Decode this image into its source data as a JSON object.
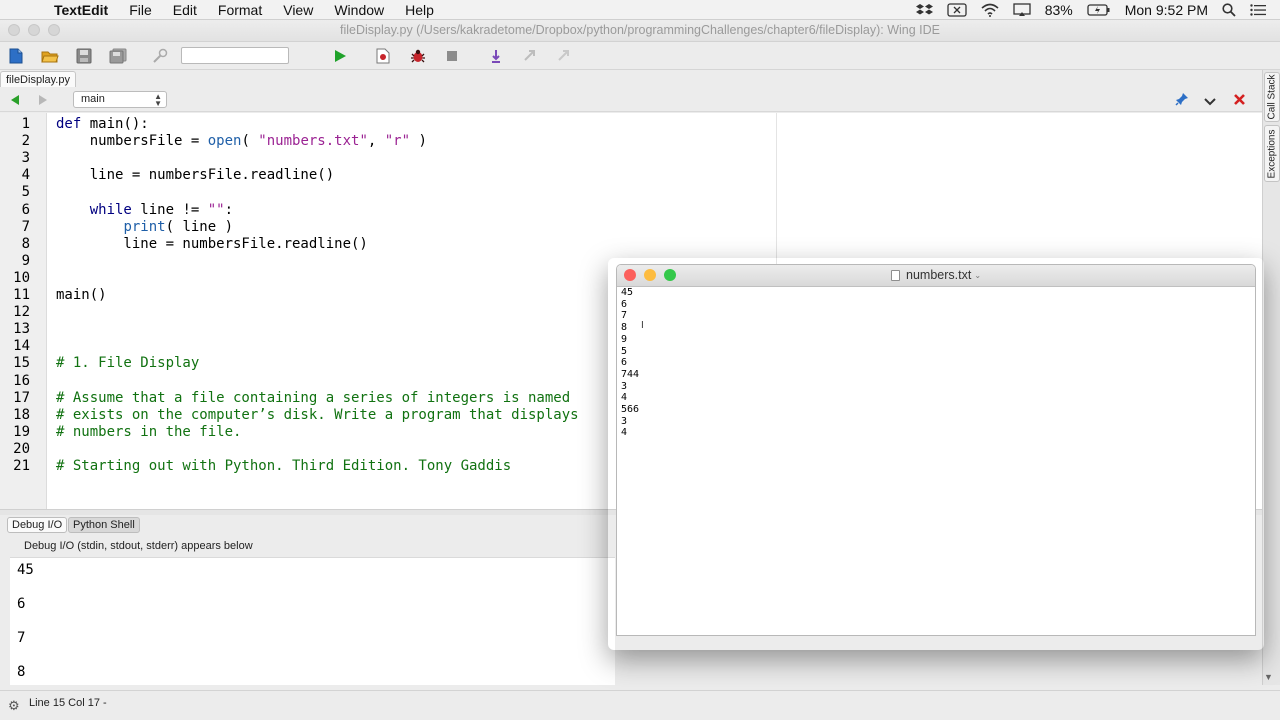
{
  "menubar": {
    "apple_glyph": "",
    "app": "TextEdit",
    "items": [
      "File",
      "Edit",
      "Format",
      "View",
      "Window",
      "Help"
    ],
    "battery": "83%",
    "clock": "Mon 9:52 PM"
  },
  "window": {
    "title": "fileDisplay.py (/Users/kakradetome/Dropbox/python/programmingChallenges/chapter6/fileDisplay): Wing IDE"
  },
  "toolbar": {
    "search_value": ""
  },
  "editor": {
    "file_tab": "fileDisplay.py",
    "scope": "main",
    "lines": [
      {
        "n": "1",
        "t": "def main():"
      },
      {
        "n": "2",
        "t": "    numbersFile = open( \"numbers.txt\", \"r\" )"
      },
      {
        "n": "3",
        "t": ""
      },
      {
        "n": "4",
        "t": "    line = numbersFile.readline()"
      },
      {
        "n": "5",
        "t": ""
      },
      {
        "n": "6",
        "t": "    while line != \"\":"
      },
      {
        "n": "7",
        "t": "        print( line )"
      },
      {
        "n": "8",
        "t": "        line = numbersFile.readline()"
      },
      {
        "n": "9",
        "t": ""
      },
      {
        "n": "10",
        "t": ""
      },
      {
        "n": "11",
        "t": "main()"
      },
      {
        "n": "12",
        "t": ""
      },
      {
        "n": "13",
        "t": ""
      },
      {
        "n": "14",
        "t": ""
      },
      {
        "n": "15",
        "t": "# 1. File Display"
      },
      {
        "n": "16",
        "t": ""
      },
      {
        "n": "17",
        "t": "# Assume that a file containing a series of integers is named "
      },
      {
        "n": "18",
        "t": "# exists on the computer’s disk. Write a program that displays"
      },
      {
        "n": "19",
        "t": "# numbers in the file."
      },
      {
        "n": "20",
        "t": ""
      },
      {
        "n": "21",
        "t": "# Starting out with Python. Third Edition. Tony Gaddis"
      }
    ]
  },
  "side_tabs": [
    "Call Stack",
    "Exceptions"
  ],
  "panel": {
    "tabs": [
      "Debug I/O",
      "Python Shell"
    ],
    "caption": "Debug I/O (stdin, stdout, stderr) appears below",
    "output": [
      "45",
      "6",
      "7",
      "8"
    ]
  },
  "status": {
    "text": "Line 15 Col 17 -"
  },
  "textedit": {
    "title": "numbers.txt",
    "lines": [
      "45",
      "6",
      "7",
      "8",
      "9",
      "5",
      "6",
      "744",
      "3",
      "4",
      "566",
      "3",
      "4"
    ]
  },
  "colors": {
    "close_red": "#fc605c",
    "minimize_yellow": "#fdbc40",
    "zoom_green": "#34c84a",
    "comment_green": "#117211",
    "run_green": "#1fa22a"
  }
}
